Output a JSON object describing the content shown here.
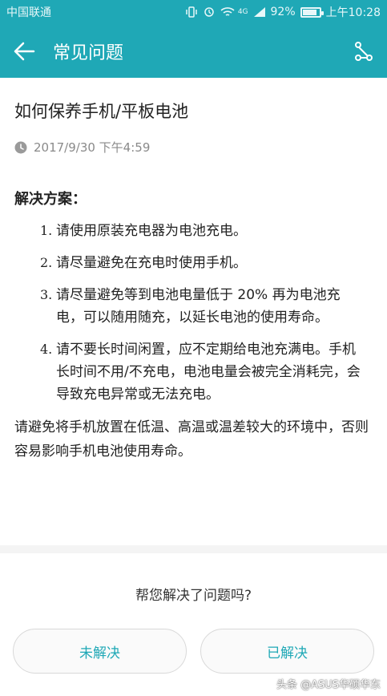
{
  "status_bar": {
    "carrier": "中国联通",
    "network": "4G",
    "battery": "92%",
    "time": "上午10:28"
  },
  "app_bar": {
    "title": "常见问题",
    "back_icon": "arrow-left-icon",
    "share_icon": "share-icon"
  },
  "article": {
    "title": "如何保养手机/平板电池",
    "date": "2017/9/30 下午4:59",
    "solution_heading": "解决方案：",
    "steps": [
      {
        "num": "1.",
        "text": "请使用原装充电器为电池充电。"
      },
      {
        "num": "2.",
        "text": "请尽量避免在充电时使用手机。"
      },
      {
        "num": "3.",
        "text": "请尽量避免等到电池电量低于 20% 再为电池充电，可以随用随充，以延长电池的使用寿命。"
      },
      {
        "num": "4.",
        "text": "请不要长时间闲置，应不定期给电池充满电。手机长时间不用/不充电，电池电量会被完全消耗完，会导致充电异常或无法充电。"
      }
    ],
    "note": "请避免将手机放置在低温、高温或温差较大的环境中，否则容易影响手机电池使用寿命。"
  },
  "feedback": {
    "question": "帮您解决了问题吗?",
    "unsolved_label": "未解决",
    "solved_label": "已解决"
  },
  "watermark": "头条 @ASUS华硕华东",
  "colors": {
    "accent": "#1fa8b6",
    "text": "#222222",
    "meta": "#8a8a8a"
  }
}
